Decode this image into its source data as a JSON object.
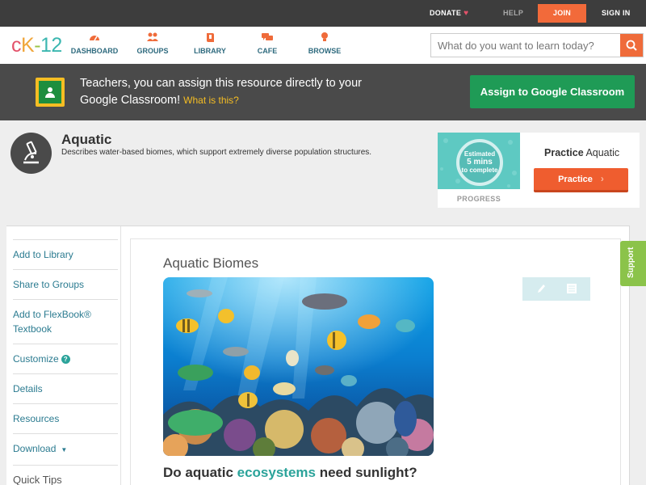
{
  "topbar": {
    "donate": "DONATE",
    "help": "HELP",
    "join": "JOIN",
    "sign_in": "SIGN IN"
  },
  "nav": {
    "logo": {
      "c": "c",
      "k": "K",
      "dash": "-",
      "num": "12"
    },
    "items": [
      {
        "label": "DASHBOARD",
        "icon": "dashboard-icon"
      },
      {
        "label": "GROUPS",
        "icon": "groups-icon"
      },
      {
        "label": "LIBRARY",
        "icon": "library-icon"
      },
      {
        "label": "CAFE",
        "icon": "cafe-icon"
      },
      {
        "label": "BROWSE",
        "icon": "browse-icon"
      }
    ],
    "search_placeholder": "What do you want to learn today?"
  },
  "classroom_banner": {
    "text": "Teachers, you can assign this resource directly to your Google Classroom!",
    "what_link": "What is this?",
    "assign_button": "Assign to Google Classroom"
  },
  "concept": {
    "title": "Aquatic",
    "description": "Describes water-based biomes, which support extremely diverse population structures."
  },
  "practice": {
    "estimate_line1": "Estimated",
    "estimate_line2": "5 mins",
    "estimate_line3": "to complete",
    "progress_label": "PROGRESS",
    "heading_bold": "Practice",
    "heading_rest": " Aquatic",
    "button": "Practice"
  },
  "sidebar": {
    "items": [
      {
        "label": "Add to Library"
      },
      {
        "label": "Share to Groups"
      },
      {
        "label": "Add to FlexBook® Textbook"
      },
      {
        "label": "Customize"
      },
      {
        "label": "Details"
      },
      {
        "label": "Resources"
      },
      {
        "label": "Download"
      },
      {
        "label": "Quick Tips"
      }
    ]
  },
  "content": {
    "title": "Aquatic Biomes",
    "question_pre": "Do aquatic ",
    "question_highlight": "ecosystems",
    "question_post": " need sunlight?"
  },
  "support_tab": "Support",
  "colors": {
    "accent_orange": "#ef6b3a",
    "link_teal": "#2b7b90",
    "google_green": "#1f9b56",
    "support_green": "#8bc34a"
  }
}
